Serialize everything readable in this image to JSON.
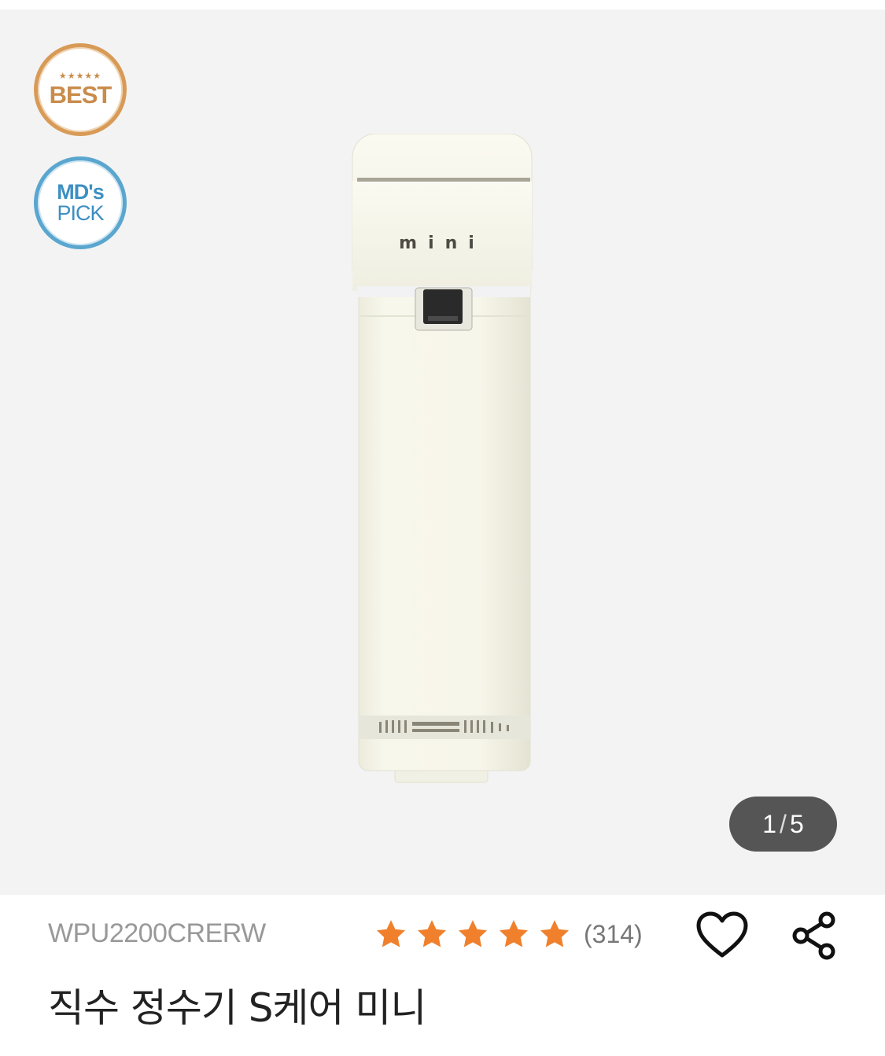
{
  "badges": {
    "best": {
      "stars": "★★★★★",
      "text": "BEST"
    },
    "md_pick": {
      "line1": "MD's",
      "line2": "PICK"
    }
  },
  "product_image": {
    "brand_text": "mini"
  },
  "gallery": {
    "current": "1",
    "separator": "/",
    "total": "5"
  },
  "product": {
    "model_code": "WPU2200CRERW",
    "rating": 5,
    "review_count": "(314)",
    "title": "직수 정수기 S케어 미니"
  },
  "icons": {
    "wishlist": "heart-icon",
    "share": "share-icon",
    "star": "star-icon"
  },
  "colors": {
    "best_badge": "#d89a57",
    "md_badge": "#5aa6cf",
    "star": "#f0802c",
    "counter_bg": "#555555",
    "gallery_bg": "#f3f3f3"
  }
}
